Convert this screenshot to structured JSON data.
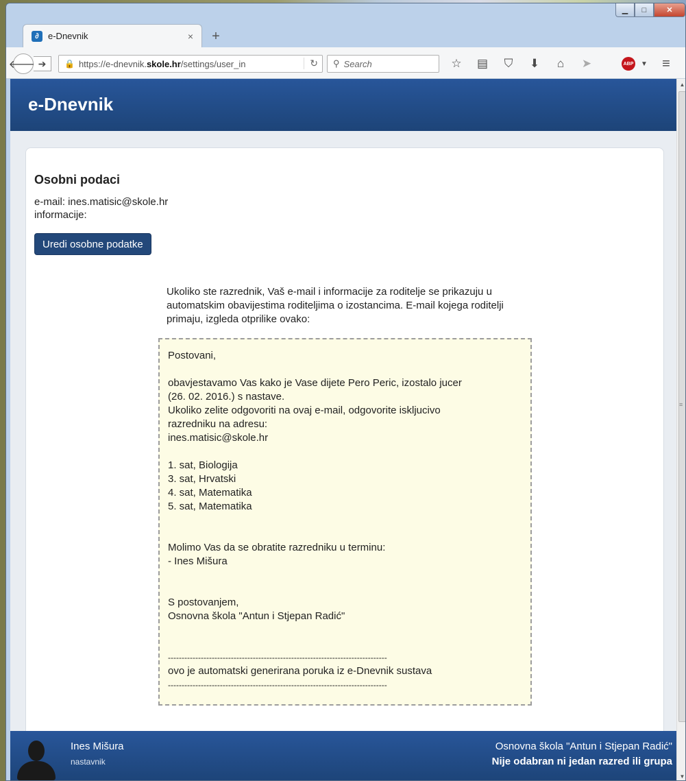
{
  "browser": {
    "tab_title": "e-Dnevnik",
    "tab_close": "×",
    "new_tab": "+",
    "url_prefix": "https://e-dnevnik.",
    "url_domain": "skole.hr",
    "url_path": "/settings/user_in",
    "search_placeholder": "Search"
  },
  "app": {
    "title": "e-Dnevnik"
  },
  "profile": {
    "section_title": "Osobni podaci",
    "email_line": "e-mail: ines.matisic@skole.hr",
    "info_line": "informacije:",
    "edit_button": "Uredi osobne podatke"
  },
  "notice": {
    "intro": "Ukoliko ste razrednik, Vaš e-mail i informacije za roditelje se prikazuju u automatskim obavijestima roditeljima o izostancima. E-mail kojega roditelji primaju, izgleda otprilike ovako:",
    "greeting": "Postovani,",
    "line1": "obavjestavamo Vas kako je Vase dijete Pero Peric, izostalo jucer",
    "line2": "(26. 02. 2016.) s nastave.",
    "line3": "Ukoliko zelite odgovoriti na ovaj e-mail, odgovorite iskljucivo",
    "line4": "razredniku na adresu:",
    "line5": "ines.matisic@skole.hr",
    "periods": [
      "1. sat, Biologija",
      "3. sat, Hrvatski",
      "4. sat, Matematika",
      "5. sat, Matematika"
    ],
    "contact_line": "Molimo Vas da se obratite razredniku u terminu:",
    "contact_name": "- Ines Mišura",
    "closing": "S postovanjem,",
    "school": "Osnovna škola \"Antun i Stjepan Radić\"",
    "separator": "--------------------------------------------------------------------------------",
    "auto_note": "ovo je automatski generirana poruka iz e-Dnevnik sustava"
  },
  "footer": {
    "user_name": "Ines Mišura",
    "user_role": "nastavnik",
    "school_name": "Osnovna škola \"Antun i Stjepan Radić\"",
    "class_status": "Nije odabran ni jedan razred ili grupa"
  }
}
